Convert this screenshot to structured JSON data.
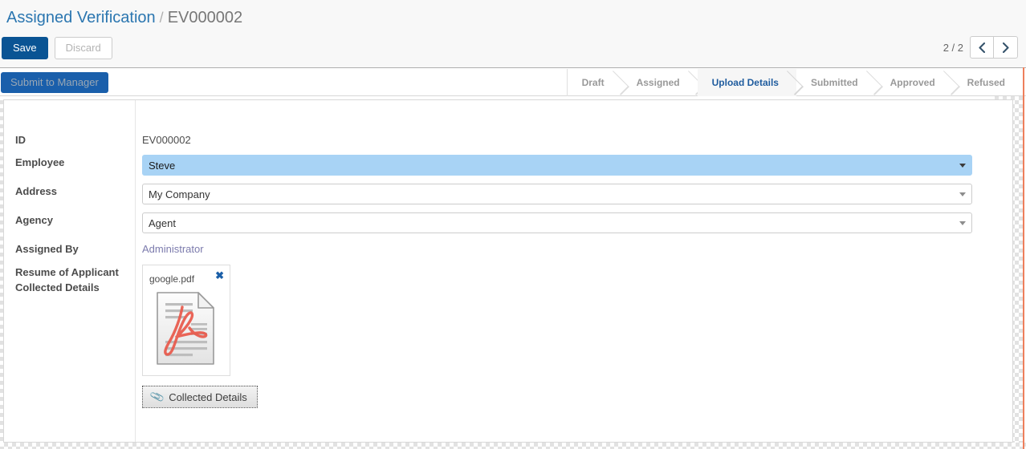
{
  "breadcrumb": {
    "parent": "Assigned Verification",
    "separator": "/",
    "current": "EV000002"
  },
  "toolbar": {
    "save_label": "Save",
    "discard_label": "Discard"
  },
  "pager": {
    "count": "2 / 2",
    "prev_icon": "chevron-left-icon",
    "next_icon": "chevron-right-icon"
  },
  "statusbar": {
    "action_button": "Submit to Manager",
    "stages": [
      {
        "label": "Draft",
        "active": false
      },
      {
        "label": "Assigned",
        "active": false
      },
      {
        "label": "Upload Details",
        "active": true
      },
      {
        "label": "Submitted",
        "active": false
      },
      {
        "label": "Approved",
        "active": false
      },
      {
        "label": "Refused",
        "active": false
      }
    ]
  },
  "form": {
    "fields": [
      {
        "label": "ID",
        "value": "EV000002",
        "type": "static"
      },
      {
        "label": "Employee",
        "value": "Steve",
        "type": "many2one",
        "selected": true
      },
      {
        "label": "Address",
        "value": "My Company",
        "type": "many2one",
        "selected": false
      },
      {
        "label": "Agency",
        "value": "Agent",
        "type": "many2one",
        "selected": false
      },
      {
        "label": "Assigned By",
        "value": "Administrator",
        "type": "link"
      },
      {
        "label": "Resume of Applicant Collected Details",
        "type": "attachment"
      }
    ],
    "attachment": {
      "filename": "google.pdf",
      "delete_icon": "close-icon",
      "file_icon": "pdf-file-icon",
      "upload_label": "Collected Details",
      "upload_icon": "paperclip-icon"
    },
    "external_link_icon": "external-link-icon",
    "dropdown_icon": "caret-down-icon"
  },
  "colors": {
    "primary": "#0a5494",
    "stage_active": "#1f5c9e",
    "link": "#2b76b0",
    "odoo_purple": "#7c7bad",
    "selection": "#a8d3f5",
    "accent_rule": "#ee7f5c"
  }
}
